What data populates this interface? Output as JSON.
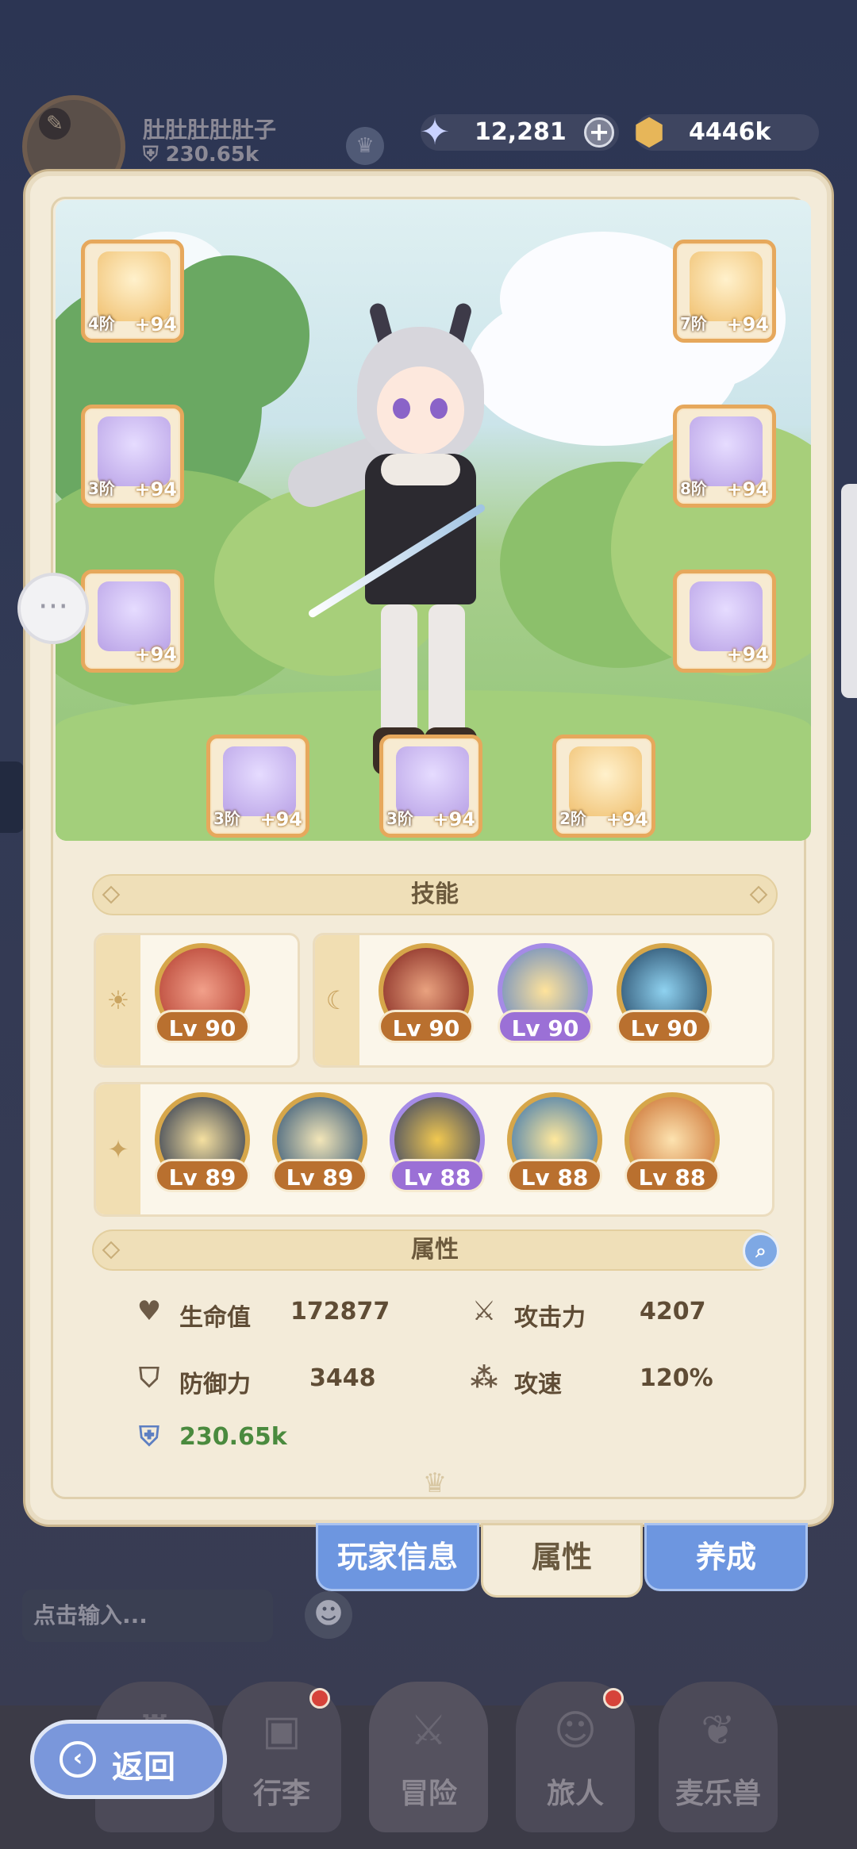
{
  "player": {
    "name": "肚肚肚肚肚子",
    "power": "230.65k"
  },
  "currencies": {
    "gems": "12,281",
    "gold": "4446k"
  },
  "equipment": {
    "left": [
      {
        "name": "weapon",
        "tier": "4阶",
        "enhance": "+94",
        "rarity": "gold"
      },
      {
        "name": "chest-armor",
        "tier": "3阶",
        "enhance": "+94",
        "rarity": "purple"
      },
      {
        "name": "pants",
        "tier": "",
        "enhance": "+94",
        "rarity": "purple"
      }
    ],
    "right": [
      {
        "name": "helmet",
        "tier": "7阶",
        "enhance": "+94",
        "rarity": "gold"
      },
      {
        "name": "gloves",
        "tier": "8阶",
        "enhance": "+94",
        "rarity": "purple"
      },
      {
        "name": "boots",
        "tier": "",
        "enhance": "+94",
        "rarity": "purple"
      }
    ],
    "bottom": [
      {
        "name": "ring",
        "tier": "3阶",
        "enhance": "+94",
        "rarity": "purple"
      },
      {
        "name": "necklace",
        "tier": "3阶",
        "enhance": "+94",
        "rarity": "purple"
      },
      {
        "name": "charm",
        "tier": "2阶",
        "enhance": "+94",
        "rarity": "gold"
      }
    ]
  },
  "skills_section": {
    "title": "技能"
  },
  "skills": {
    "sun": [
      {
        "lv": "Lv 90",
        "color": "gold"
      }
    ],
    "moon": [
      {
        "lv": "Lv 90",
        "color": "gold"
      },
      {
        "lv": "Lv 90",
        "color": "purple"
      },
      {
        "lv": "Lv 90",
        "color": "gold"
      }
    ],
    "star": [
      {
        "lv": "Lv 89",
        "color": "gold"
      },
      {
        "lv": "Lv 89",
        "color": "gold"
      },
      {
        "lv": "Lv 88",
        "color": "purple"
      },
      {
        "lv": "Lv 88",
        "color": "gold"
      },
      {
        "lv": "Lv 88",
        "color": "gold"
      }
    ]
  },
  "attributes_section": {
    "title": "属性"
  },
  "stats": {
    "hp": {
      "name": "生命值",
      "value": "172877"
    },
    "atk": {
      "name": "攻击力",
      "value": "4207"
    },
    "def": {
      "name": "防御力",
      "value": "3448"
    },
    "spd": {
      "name": "攻速",
      "value": "120%"
    },
    "power": {
      "value": "230.65k"
    }
  },
  "tabs": {
    "player_info": "玩家信息",
    "attributes": "属性",
    "develop": "养成"
  },
  "chat": {
    "placeholder": "点击输入..."
  },
  "nav": {
    "bag": "行李",
    "adventure": "冒险",
    "traveler": "旅人",
    "pets": "麦乐兽",
    "back": "返回"
  },
  "colors": {
    "accent_blue": "#6d96e0",
    "panel": "#f3ebd9",
    "slot_border": "#e6a85c",
    "level_badge": "#b9702f",
    "level_badge_purple": "#9b70d6",
    "power_green": "#4a8a3e"
  }
}
